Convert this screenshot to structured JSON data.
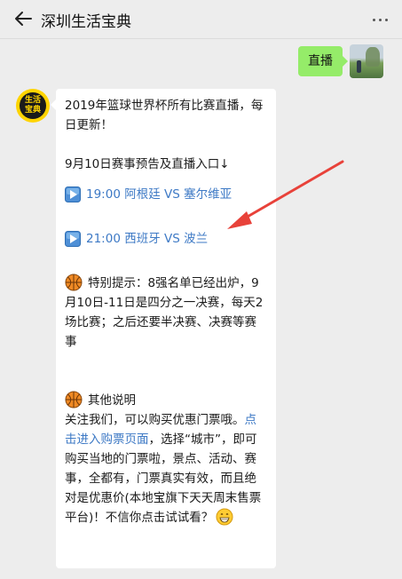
{
  "header": {
    "title": "深圳生活宝典"
  },
  "outgoing": {
    "text": "直播"
  },
  "bot": {
    "avatar_text_1": "生活",
    "avatar_text_2": "宝典"
  },
  "message": {
    "intro": "2019年篮球世界杯所有比赛直播，每日更新！",
    "preview_title": "9月10日赛事预告及直播入口↓",
    "match1": "19:00 阿根廷 VS 塞尔维亚",
    "match2": "21:00 西班牙 VS 波兰",
    "tip": "特别提示：8强名单已经出炉，9月10日-11日是四分之一决赛，每天2场比赛；之后还要半决赛、决赛等赛事",
    "other_title": "其他说明",
    "other_pre": "关注我们，可以购买优惠门票哦。",
    "other_link": "点击进入购票页面",
    "other_post": "，选择“城市”，即可购买当地的门票啦，景点、活动、赛事，全都有，门票真实有效，而且绝对是优惠价(本地宝旗下天天周末售票平台)！不信你点击试试看？"
  },
  "colors": {
    "link": "#3d79c5",
    "outgoing_bubble": "#95ec69",
    "annotation_arrow": "#e8423a"
  },
  "icons": [
    "back-arrow-icon",
    "more-dots-icon",
    "play-button-icon",
    "basketball-icon",
    "grin-emoji-icon"
  ]
}
